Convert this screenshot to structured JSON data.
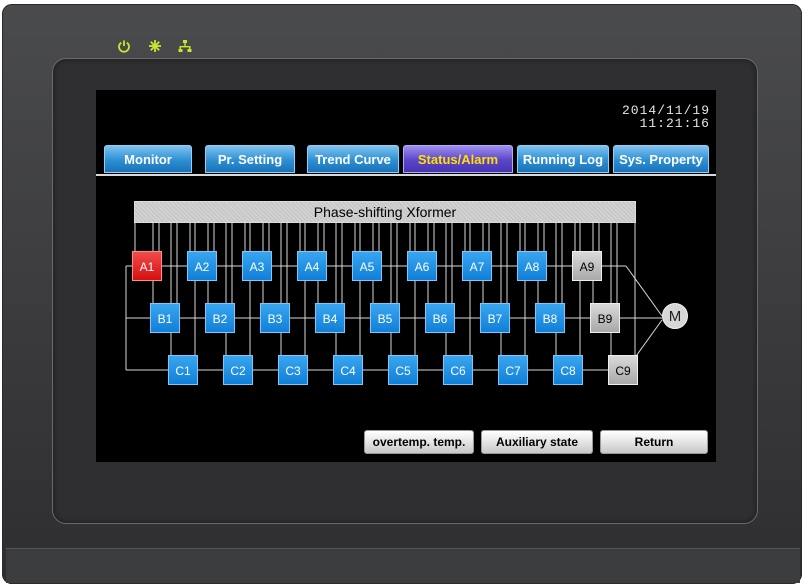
{
  "indicators": [
    {
      "name": "power-icon",
      "glyph": "⏻",
      "color": "#c8e62b"
    },
    {
      "name": "run-icon",
      "glyph": "✳",
      "color": "#c8e62b"
    },
    {
      "name": "network-icon",
      "glyph": "🖧",
      "color": "#c8e62b"
    }
  ],
  "datetime": {
    "date": "2014/11/19",
    "time": "11:21:16"
  },
  "tabs": [
    {
      "label": "Monitor"
    },
    {
      "label": "Pr. Setting"
    },
    {
      "label": "Trend Curve"
    },
    {
      "label": "Status/Alarm",
      "active": true
    },
    {
      "label": "Running Log"
    },
    {
      "label": "Sys. Property"
    }
  ],
  "diagram": {
    "xformer_label": "Phase-shifting Xformer",
    "motor_label": "M",
    "row_a": [
      {
        "label": "A1",
        "state": "fault"
      },
      {
        "label": "A2",
        "state": "normal"
      },
      {
        "label": "A3",
        "state": "normal"
      },
      {
        "label": "A4",
        "state": "normal"
      },
      {
        "label": "A5",
        "state": "normal"
      },
      {
        "label": "A6",
        "state": "normal"
      },
      {
        "label": "A7",
        "state": "normal"
      },
      {
        "label": "A8",
        "state": "normal"
      },
      {
        "label": "A9",
        "state": "off"
      }
    ],
    "row_b": [
      {
        "label": "B1",
        "state": "normal"
      },
      {
        "label": "B2",
        "state": "normal"
      },
      {
        "label": "B3",
        "state": "normal"
      },
      {
        "label": "B4",
        "state": "normal"
      },
      {
        "label": "B5",
        "state": "normal"
      },
      {
        "label": "B6",
        "state": "normal"
      },
      {
        "label": "B7",
        "state": "normal"
      },
      {
        "label": "B8",
        "state": "normal"
      },
      {
        "label": "B9",
        "state": "off"
      }
    ],
    "row_c": [
      {
        "label": "C1",
        "state": "normal"
      },
      {
        "label": "C2",
        "state": "normal"
      },
      {
        "label": "C3",
        "state": "normal"
      },
      {
        "label": "C4",
        "state": "normal"
      },
      {
        "label": "C5",
        "state": "normal"
      },
      {
        "label": "C6",
        "state": "normal"
      },
      {
        "label": "C7",
        "state": "normal"
      },
      {
        "label": "C8",
        "state": "normal"
      },
      {
        "label": "C9",
        "state": "off"
      }
    ]
  },
  "footer": {
    "overtemp_label": "overtemp. temp.",
    "auxiliary_label": "Auxiliary state",
    "return_label": "Return"
  },
  "colors": {
    "fault": "#e01e1e",
    "normal": "#1e8fe6",
    "off": "#c0c0c0",
    "active_tab_text": "#ffe000"
  }
}
